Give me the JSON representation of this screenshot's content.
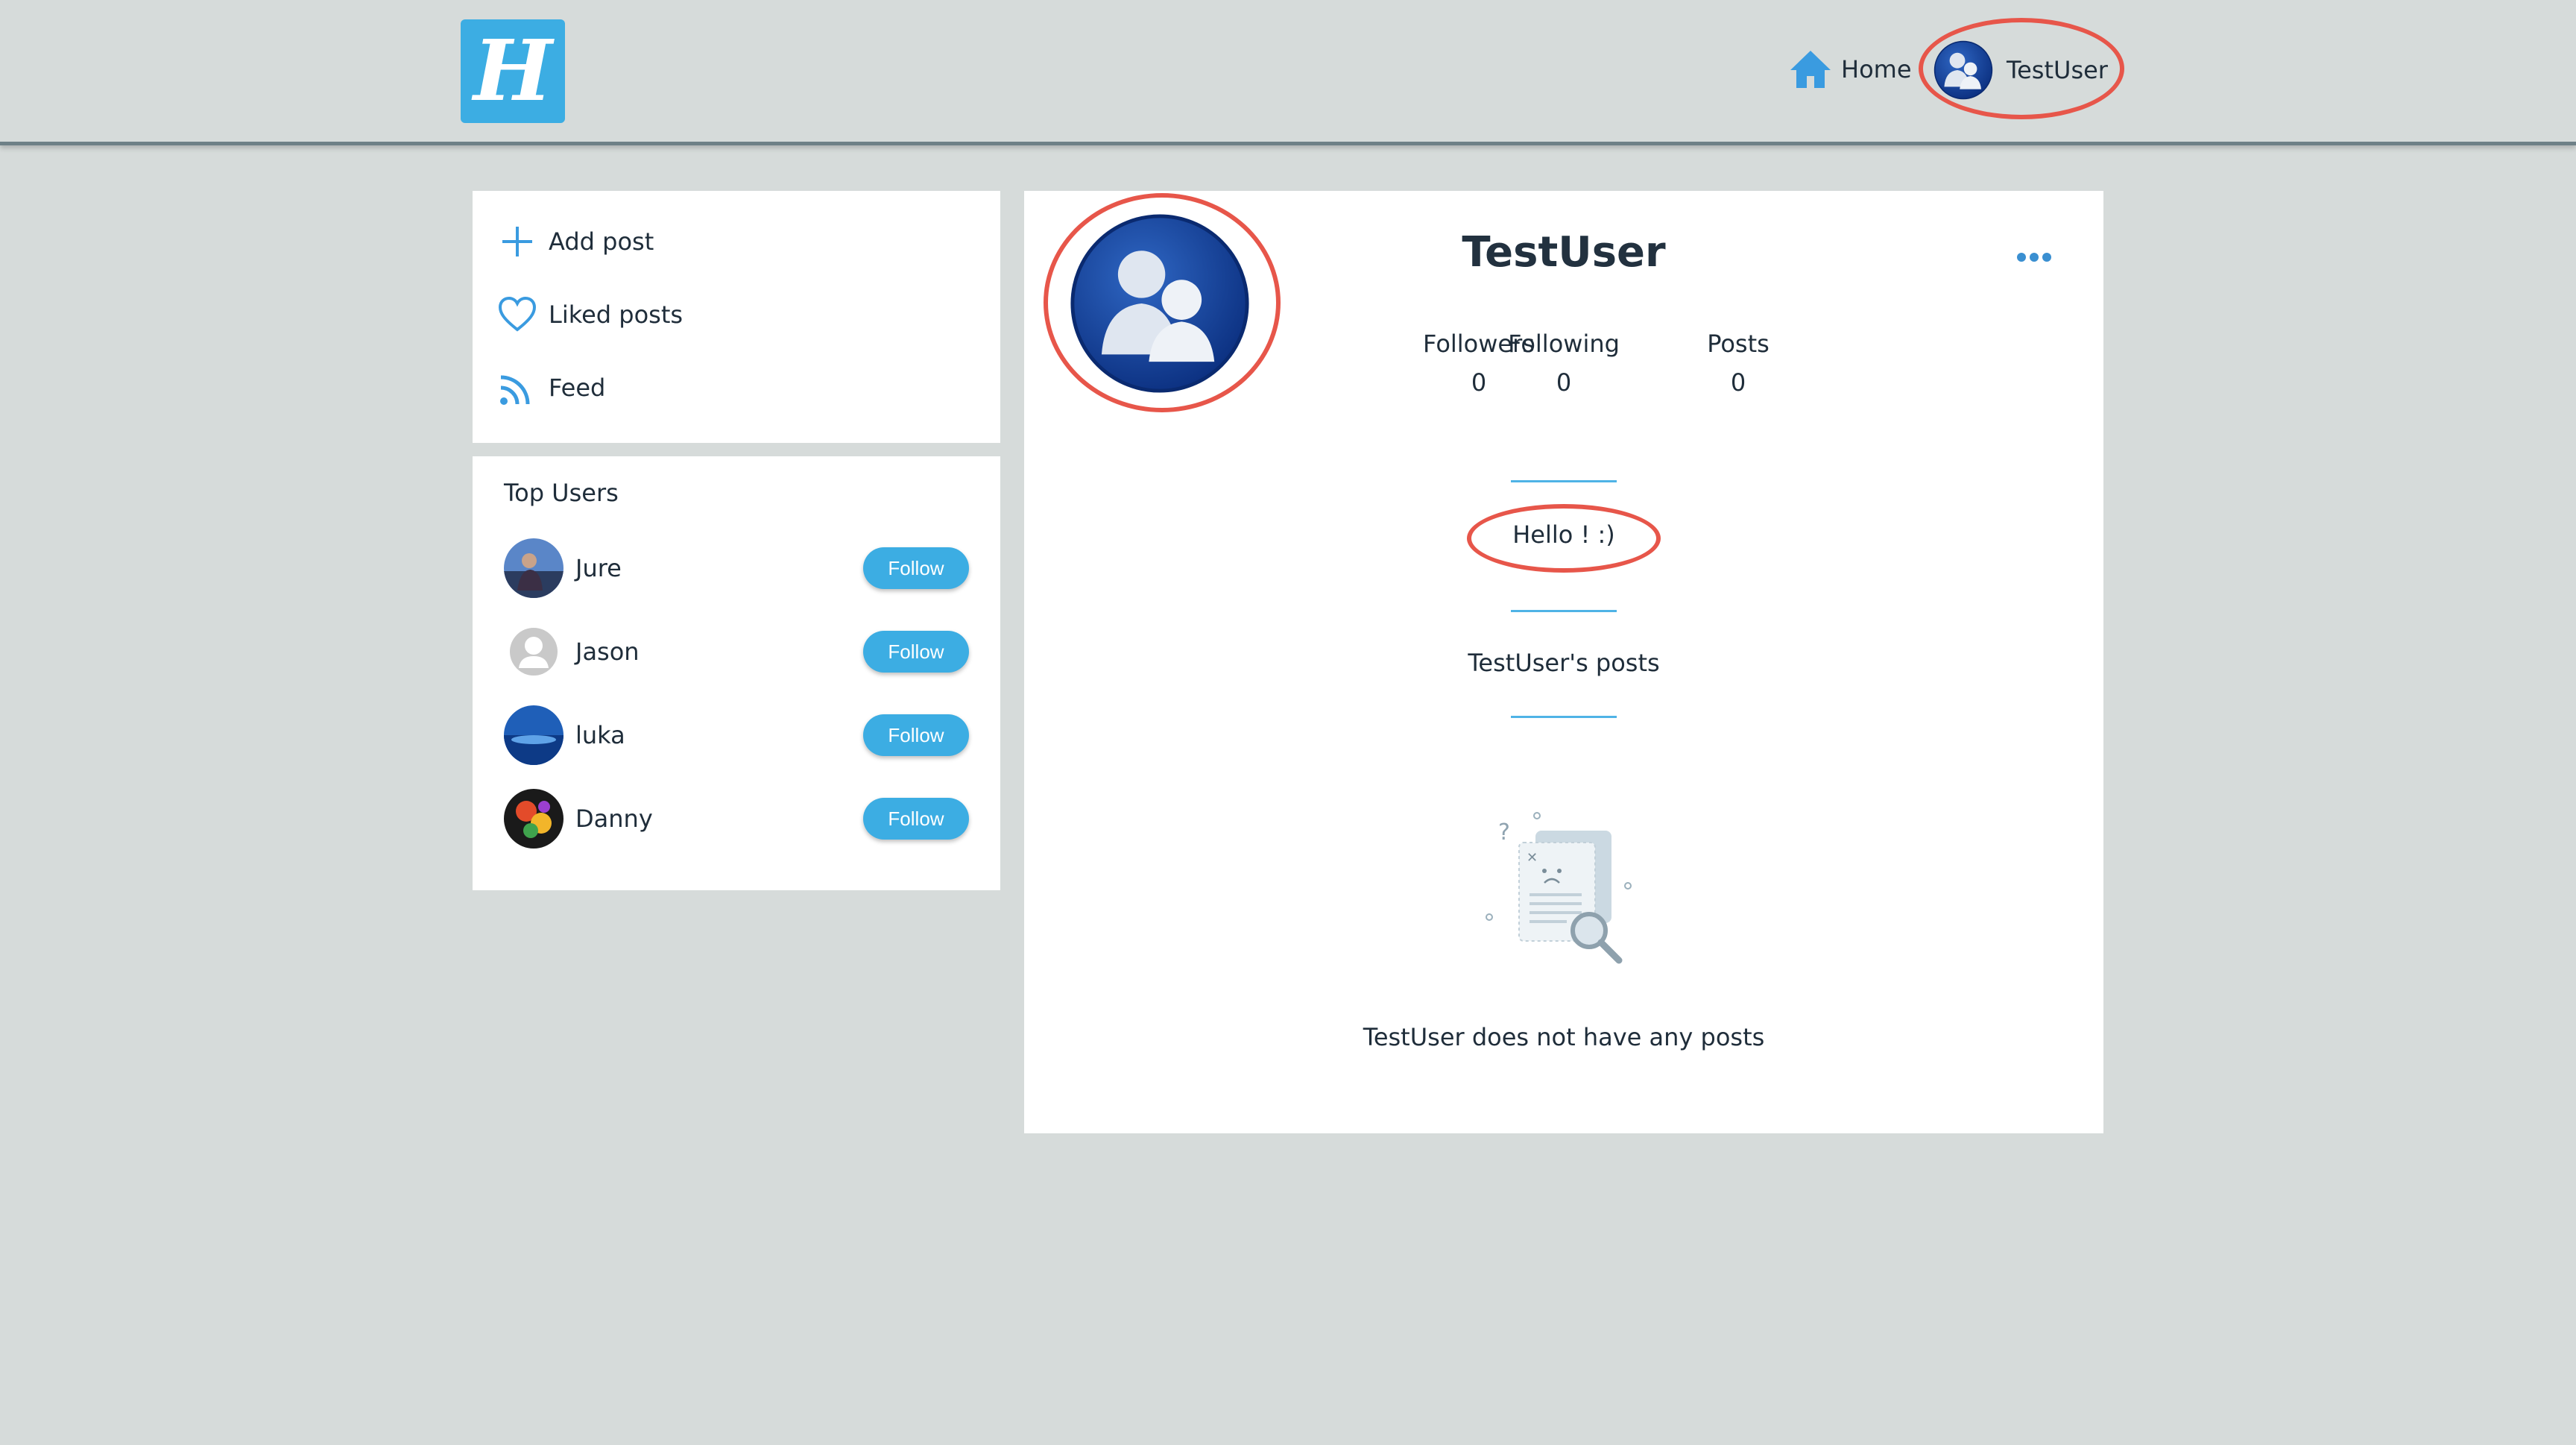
{
  "header": {
    "logo_letter": "H",
    "nav": {
      "home_label": "Home",
      "user_label": "TestUser"
    }
  },
  "sidebar": {
    "menu": [
      {
        "label": "Add post",
        "icon": "plus-icon"
      },
      {
        "label": "Liked posts",
        "icon": "heart-icon"
      },
      {
        "label": "Feed",
        "icon": "rss-icon"
      }
    ],
    "top_users": {
      "title": "Top Users",
      "users": [
        {
          "name": "Jure",
          "button": "Follow"
        },
        {
          "name": "Jason",
          "button": "Follow"
        },
        {
          "name": "luka",
          "button": "Follow"
        },
        {
          "name": "Danny",
          "button": "Follow"
        }
      ]
    }
  },
  "profile": {
    "username": "TestUser",
    "stats": [
      {
        "label": "Followers",
        "value": "0"
      },
      {
        "label": "Following",
        "value": "0"
      },
      {
        "label": "Posts",
        "value": "0"
      }
    ],
    "bio": "Hello ! :)",
    "posts_title": "TestUser's posts",
    "empty_message": "TestUser does not have any posts"
  },
  "colors": {
    "accent": "#3cade3",
    "highlight_ring": "#e7564a",
    "background": "#d6dbda"
  }
}
